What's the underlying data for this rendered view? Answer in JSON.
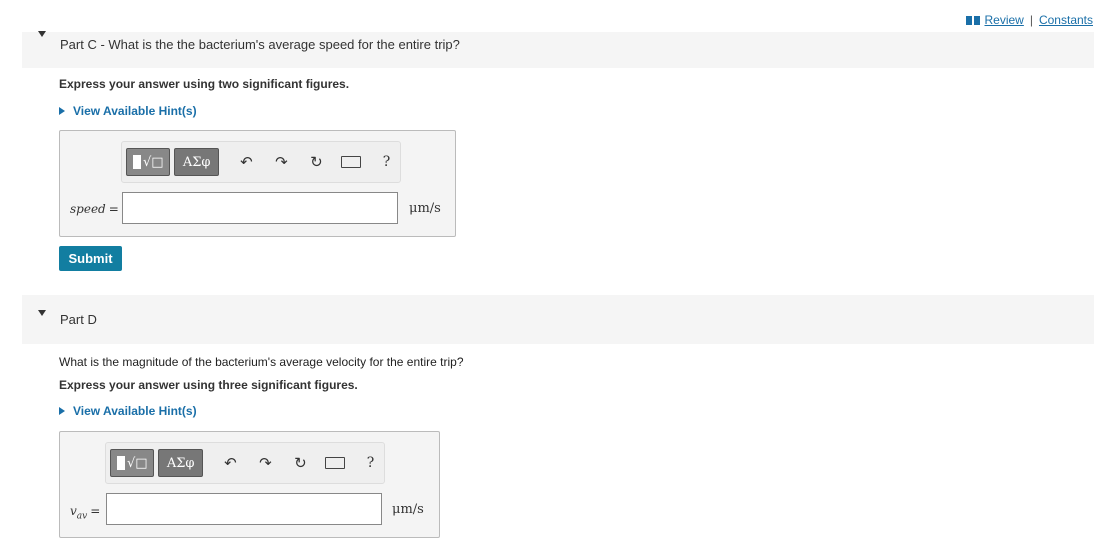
{
  "top_links": {
    "review": "Review",
    "separator": "|",
    "constants": "Constants"
  },
  "part_c": {
    "title": "Part C - What is the the bacterium's average speed for the entire trip?",
    "instruction": "Express your answer using two significant figures.",
    "hint_label": "View Available Hint(s)",
    "answer": {
      "label": "speed",
      "equals": "=",
      "value": "",
      "unit": "μm/s"
    },
    "toolbar": {
      "templates_glyph": "√□",
      "greek_label": "ΑΣφ",
      "help": "?"
    },
    "submit_label": "Submit"
  },
  "part_d": {
    "title": "Part D",
    "question": "What is the magnitude of the bacterium's average velocity for the entire trip?",
    "instruction": "Express your answer using three significant figures.",
    "hint_label": "View Available Hint(s)",
    "answer": {
      "label": "v",
      "label_sub": "av",
      "equals": "=",
      "value": "",
      "unit": "μm/s"
    },
    "toolbar": {
      "templates_glyph": "√□",
      "greek_label": "ΑΣφ",
      "help": "?"
    }
  },
  "icons": {
    "undo": "undo-icon",
    "redo": "redo-icon",
    "reset": "reset-icon",
    "keyboard": "keyboard-icon",
    "collapse": "chevron-down-icon",
    "hint_expand": "chevron-right-icon",
    "book": "book-icon"
  },
  "colors": {
    "link": "#1a6fa8",
    "submit_bg": "#127ea1",
    "header_bg": "#f5f5f5"
  }
}
